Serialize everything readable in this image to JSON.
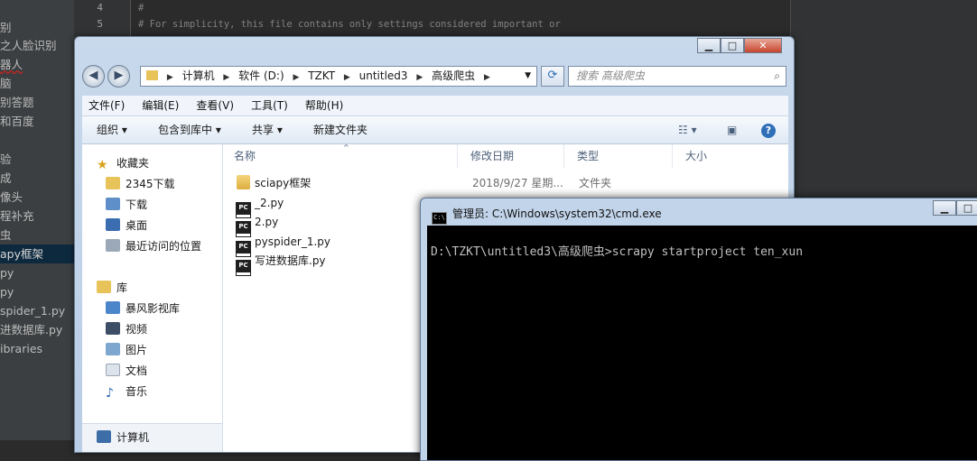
{
  "ide": {
    "sidebar_items": [
      "别",
      "之人脸识别",
      "器人",
      "脑",
      "别答题",
      "和百度",
      "",
      "验",
      "成",
      "像头",
      "程补充",
      "虫",
      "apy框架",
      "py",
      "py",
      "spider_1.py",
      "进数据库.py",
      "ibraries"
    ],
    "selected_index": 12,
    "line_numbers": [
      "4",
      "5"
    ],
    "code_lines": [
      "#",
      "# For simplicity, this file contains only settings considered important or"
    ]
  },
  "explorer": {
    "window_buttons": {
      "minimize": "▁",
      "maximize": "□",
      "close": "✕"
    },
    "nav_back_icon": "back-arrow-icon",
    "address_segments": [
      "计算机",
      "软件 (D:)",
      "TZKT",
      "untitled3",
      "高级爬虫"
    ],
    "search_placeholder": "搜索 高级爬虫",
    "menu": [
      "文件(F)",
      "编辑(E)",
      "查看(V)",
      "工具(T)",
      "帮助(H)"
    ],
    "toolbar": {
      "organize": "组织 ▾",
      "include": "包含到库中 ▾",
      "share": "共享 ▾",
      "new_folder": "新建文件夹"
    },
    "nav": {
      "favorites_label": "收藏夹",
      "favorites": [
        "2345下载",
        "下载",
        "桌面",
        "最近访问的位置"
      ],
      "libraries_label": "库",
      "libraries": [
        "暴风影视库",
        "视频",
        "图片",
        "文档",
        "音乐"
      ],
      "computer_label": "计算机"
    },
    "columns": {
      "name": "名称",
      "date": "修改日期",
      "type": "类型",
      "size": "大小"
    },
    "files": [
      {
        "name": "sciapy框架",
        "kind": "folder",
        "date": "2018/9/27 星期...",
        "type": "文件夹"
      },
      {
        "name": "_2.py",
        "kind": "py",
        "date": "",
        "type": ""
      },
      {
        "name": "2.py",
        "kind": "py",
        "date": "",
        "type": ""
      },
      {
        "name": "pyspider_1.py",
        "kind": "py",
        "date": "",
        "type": ""
      },
      {
        "name": "写进数据库.py",
        "kind": "py",
        "date": "",
        "type": ""
      }
    ]
  },
  "cmd": {
    "title": "管理员: C:\\Windows\\system32\\cmd.exe",
    "icon_text": "C:\\",
    "command_line": "D:\\TZKT\\untitled3\\高级爬虫>scrapy startproject ten_xun"
  }
}
